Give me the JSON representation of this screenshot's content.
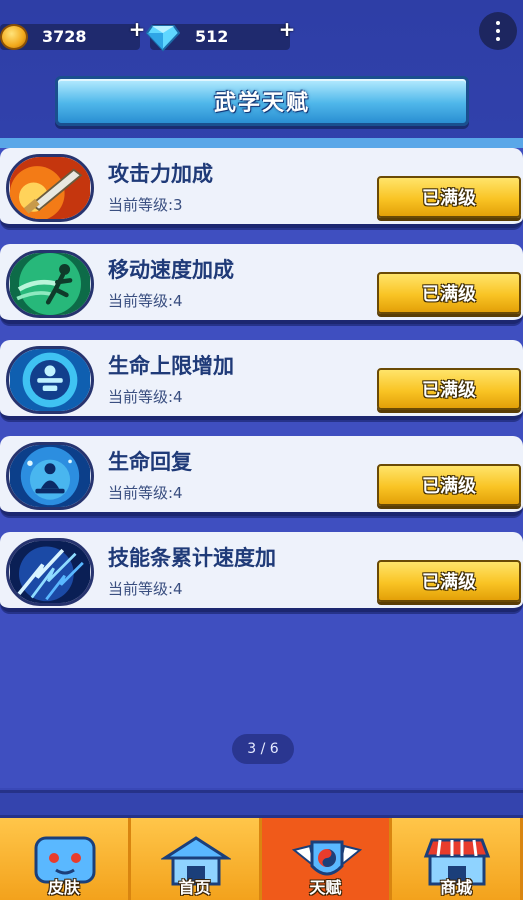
{
  "resources": {
    "coins": "3728",
    "gems": "512"
  },
  "header": {
    "title": "武学天赋"
  },
  "talents": [
    {
      "name": "攻击力加成",
      "level": "当前等级:3",
      "button": "已满级",
      "icon": "sword-fire-icon"
    },
    {
      "name": "移动速度加成",
      "level": "当前等级:4",
      "button": "已满级",
      "icon": "running-figure-icon"
    },
    {
      "name": "生命上限增加",
      "level": "当前等级:4",
      "button": "已满级",
      "icon": "health-figure-icon"
    },
    {
      "name": "生命回复",
      "level": "当前等级:4",
      "button": "已满级",
      "icon": "meditation-icon"
    },
    {
      "name": "技能条累计速度加",
      "level": "当前等级:4",
      "button": "已满级",
      "icon": "lightning-icon"
    }
  ],
  "pager": {
    "text": "3 / 6"
  },
  "nav": {
    "tabs": [
      {
        "label": "皮肤",
        "icon": "skin-face-icon",
        "active": false
      },
      {
        "label": "首页",
        "icon": "home-icon",
        "active": false
      },
      {
        "label": "天赋",
        "icon": "talent-emblem-icon",
        "active": true
      },
      {
        "label": "商城",
        "icon": "shop-icon",
        "active": false
      }
    ]
  },
  "colors": {
    "background": "#3f4fc0",
    "accent_button": "#f9c424",
    "nav_bar": "#f0a21f",
    "nav_active": "#f05a1a",
    "title_text": "#1f3a78"
  }
}
